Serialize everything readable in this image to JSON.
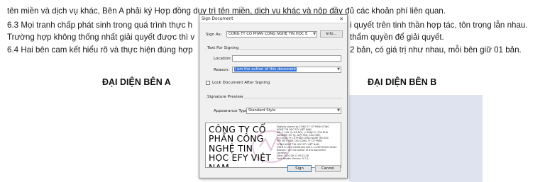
{
  "document": {
    "line1": "tên miền và dịch vụ khác, Bên A phải ký Hợp đồng duy trì tên miền, dịch vụ khác và nộp đầy đủ các khoản phí liên quan.",
    "line2_left": "6.3 Mọi tranh chấp phát sinh trong quá trình thực h",
    "line2_right": "i quyết trên tinh thần hợp tác, tôn trọng lẫn nhau.",
    "line3_left": "Trường hợp không thống nhất giải quyết được thì v",
    "line3_right": "thẩm quyền để giải quyết.",
    "line4_left": "6.4 Hai bên cam kết hiểu rõ và thực hiện đúng hợp",
    "line4_right": "2 bản, có giá trị như nhau, mỗi bên giữ 01 bản.",
    "rep_a": "ĐẠI DIỆN BÊN A",
    "rep_b": "ĐẠI DIỆN BÊN B"
  },
  "dialog": {
    "title": "Sign Document",
    "close_icon": "close-icon",
    "sign_as_label": "Sign As:",
    "sign_as_value": "CÔNG TY CỔ PHẦN CÔNG NGHỆ TIN HỌC E",
    "info_button": "Info...",
    "text_for_signing_label": "Text For Signing",
    "location_label": "Location:",
    "location_value": "",
    "reason_label": "Reason:",
    "reason_value": "I am the author of this document",
    "lock_label": "Lock Document After Signing",
    "lock_checked": false,
    "signature_preview_label": "Signature Preview",
    "appearance_type_label": "Appearance Type:",
    "appearance_type_value": "Standard Style",
    "preview": {
      "name": "CÔNG TY CỔ PHẦN CÔNG NGHỆ TIN HỌC EFY VIỆT NAM",
      "details": [
        "Digitally signed by CÔNG TY CỔ PHẦN CÔNG",
        "NGHỆ TIN HỌC EFY VIỆT NAM",
        "DN: C=VN, S=HÀ NỘI, L=TẦNG 9, TÒA NHÀ",
        "SANNAM, SỐ 78, DUY TÂN, CẦU GIẤY,",
        "O=CÔNG TY CỔ PHẦN CÔNG NGHỆ TIN HỌC",
        "EFY VIỆT NAM, CN=CÔNG TY CỔ PHẦN",
        "CÔNG NGHỆ TIN HỌC EFY VIỆT NAM,",
        "OID.0.9.2342.19200300.100.1.1=MST:0102519041",
        "Reason: I am the author of this document",
        "Location:",
        "Date: 2020-09-12 09:22:28",
        "Foxit Reader Version: 9.7.0"
      ]
    },
    "sign_button": "Sign",
    "cancel_button": "Cancel"
  },
  "colors": {
    "signature_box": "#dfe3ef",
    "selection": "#3a77d8",
    "dialog_bg": "#f0f0f0"
  }
}
